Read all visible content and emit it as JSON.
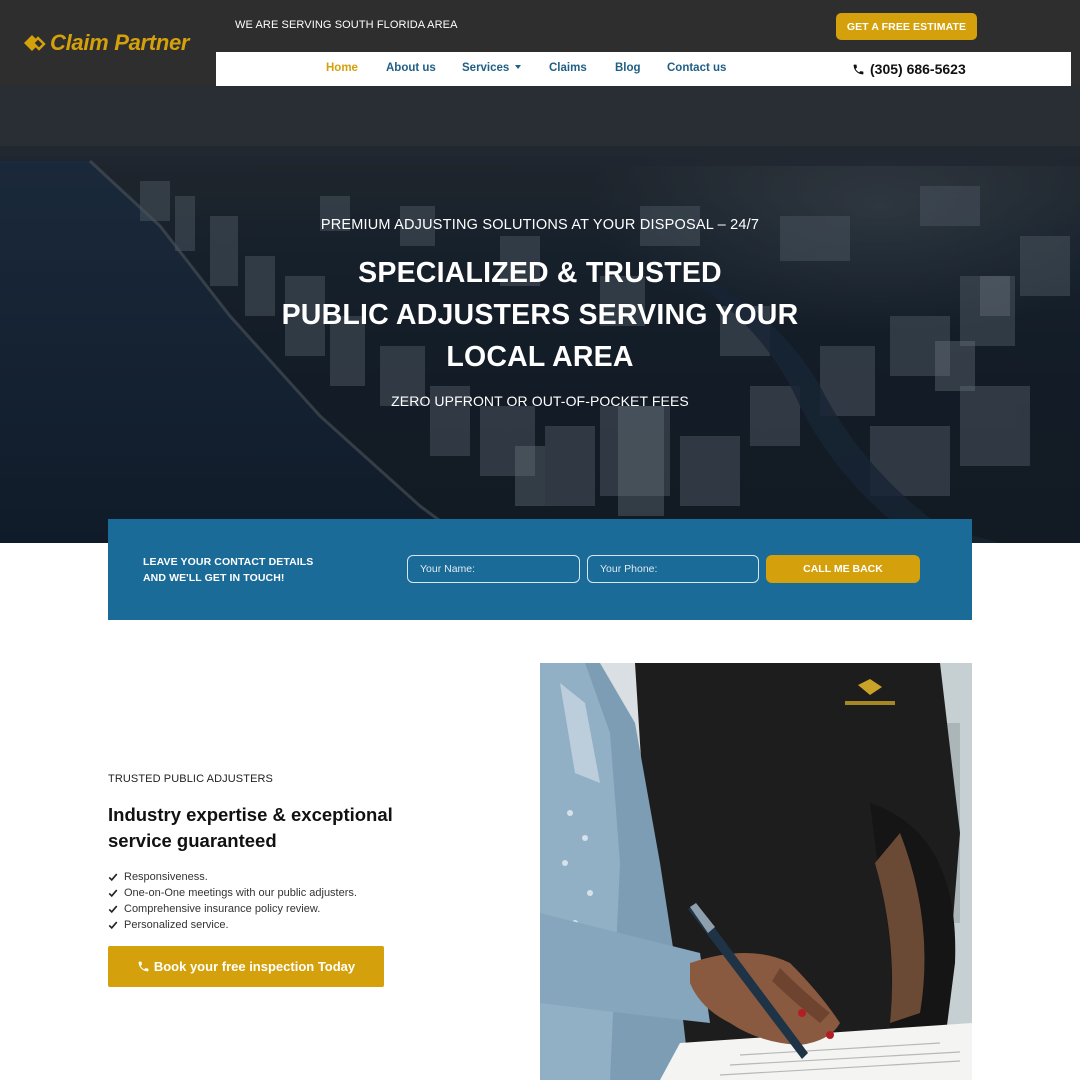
{
  "header": {
    "logo_text": "Claim Partner",
    "serving_text": "WE ARE SERVING SOUTH FLORIDA AREA",
    "estimate_label": "GET A FREE ESTIMATE",
    "phone": "(305) 686-5623",
    "nav": [
      {
        "label": "Home",
        "active": true
      },
      {
        "label": "About us"
      },
      {
        "label": "Services",
        "has_dropdown": true
      },
      {
        "label": "Claims"
      },
      {
        "label": "Blog"
      },
      {
        "label": "Contact us"
      }
    ]
  },
  "hero": {
    "kicker": "PREMIUM ADJUSTING SOLUTIONS AT YOUR DISPOSAL – 24/7",
    "title_line1": "SPECIALIZED & TRUSTED",
    "title_line2": "PUBLIC ADJUSTERS SERVING YOUR",
    "title_line3": "LOCAL AREA",
    "subtitle": "ZERO UPFRONT OR OUT-OF-POCKET FEES"
  },
  "contact": {
    "text_line1": "LEAVE YOUR CONTACT DETAILS",
    "text_line2": "AND WE'LL GET IN TOUCH!",
    "name_placeholder": "Your Name:",
    "phone_placeholder": "Your Phone:",
    "button_label": "CALL ME BACK"
  },
  "features": {
    "eyebrow": "TRUSTED PUBLIC ADJUSTERS",
    "title": "Industry expertise & exceptional service guaranteed",
    "items": [
      "Responsiveness.",
      "One-on-One meetings with our public adjusters.",
      "Comprehensive insurance policy review.",
      "Personalized service."
    ],
    "button_label": "Book your free inspection Today"
  },
  "colors": {
    "brand_gold": "#d4a10c",
    "dark_header": "#2e2e2e",
    "contact_blue": "#1a6b98",
    "nav_blue": "#1f5f86"
  },
  "icons": [
    "claim-partner-logo-icon",
    "phone-icon",
    "chevron-down-icon",
    "check-icon"
  ]
}
